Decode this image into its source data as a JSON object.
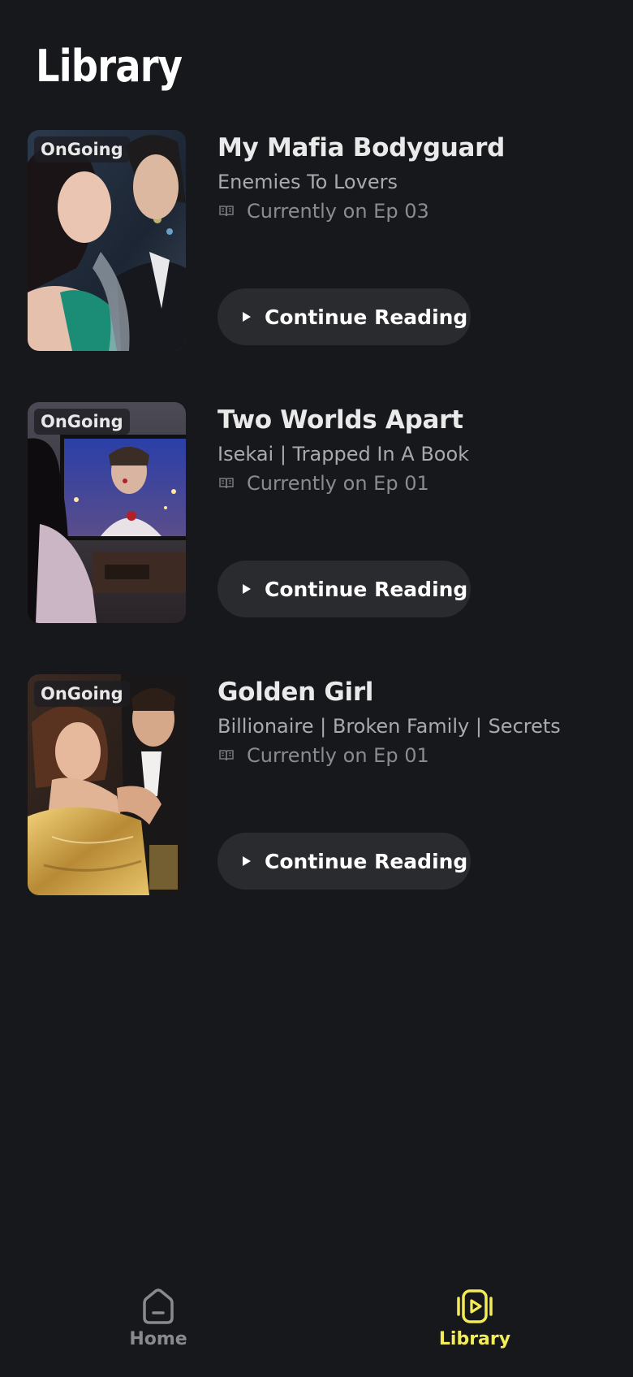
{
  "header": {
    "title": "Library"
  },
  "books": [
    {
      "badge": "OnGoing",
      "title": "My Mafia Bodyguard",
      "genres": "Enemies To Lovers",
      "progress": "Currently on Ep 03",
      "button_label": "Continue Reading"
    },
    {
      "badge": "OnGoing",
      "title": "Two Worlds Apart",
      "genres": "Isekai | Trapped In A Book",
      "progress": "Currently on Ep 01",
      "button_label": "Continue Reading"
    },
    {
      "badge": "OnGoing",
      "title": "Golden Girl",
      "genres": "Billionaire | Broken Family | Secrets",
      "progress": "Currently on Ep 01",
      "button_label": "Continue Reading"
    }
  ],
  "bottom_nav": {
    "items": [
      {
        "label": "Home",
        "icon": "home-icon",
        "active": false
      },
      {
        "label": "Library",
        "icon": "library-play-icon",
        "active": true
      }
    ]
  },
  "colors": {
    "background": "#17181c",
    "button": "#2a2b2f",
    "accent": "#f3ec57",
    "inactive": "#8a8a8e"
  }
}
